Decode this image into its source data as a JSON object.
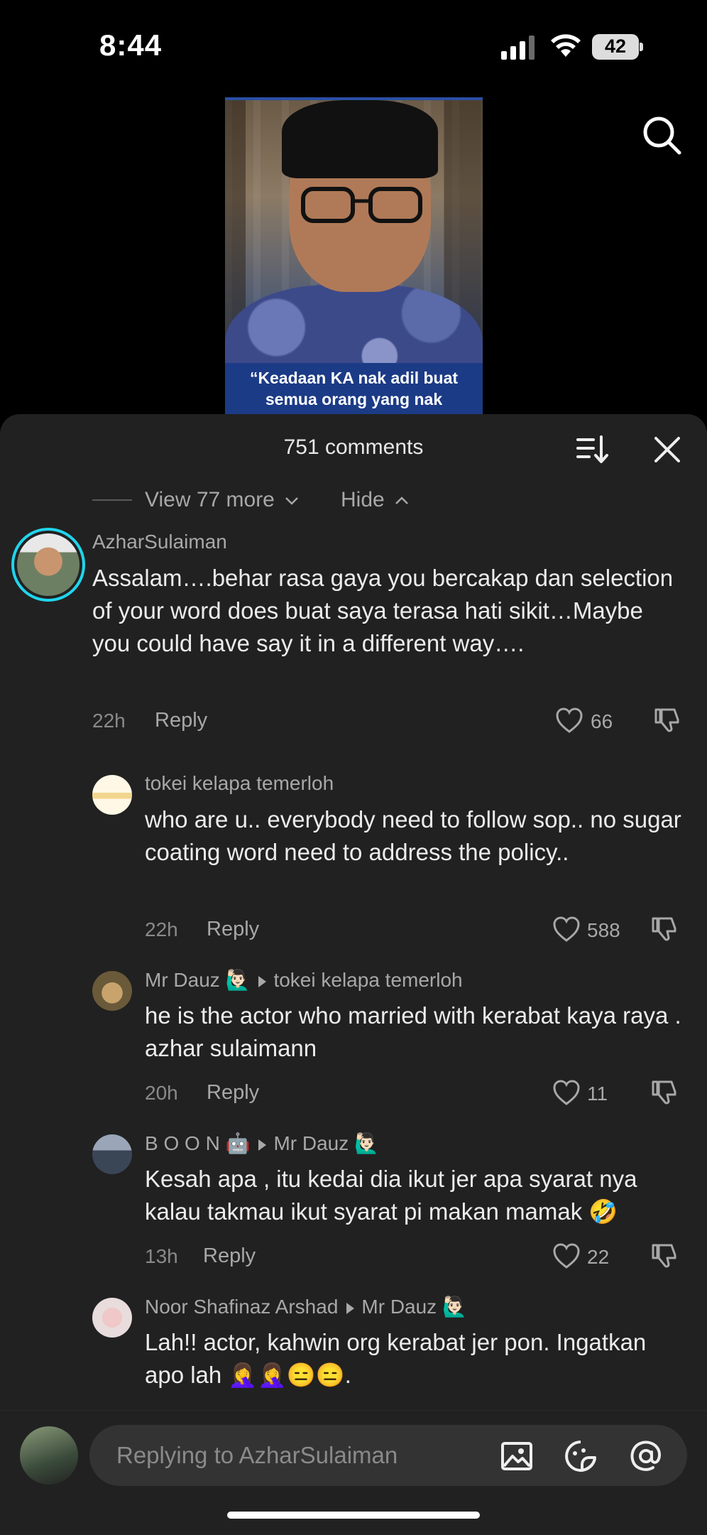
{
  "status": {
    "time": "8:44",
    "battery": "42"
  },
  "video": {
    "caption": "“Keadaan KA nak adil buat semua orang yang nak"
  },
  "header": {
    "count": "751 comments"
  },
  "thread": {
    "view_more": "View 77 more",
    "hide": "Hide"
  },
  "comments": [
    {
      "user": "AzharSulaiman",
      "text": "Assalam….behar rasa gaya you bercakap dan selection of your word does buat saya terasa hati sikit…Maybe you could have say it in a different way….",
      "time": "22h",
      "reply": "Reply",
      "likes": "66"
    },
    {
      "user": "tokei kelapa temerloh",
      "text": "who are u.. everybody need to follow sop.. no sugar coating word need to address the policy..",
      "time": "22h",
      "reply": "Reply",
      "likes": "588"
    },
    {
      "user": "Mr Dauz",
      "user_emoji": "🙋🏻‍♂️",
      "reply_to": "tokei kelapa temerloh",
      "text": "he is the actor who married with kerabat kaya raya . azhar sulaimann",
      "time": "20h",
      "reply": "Reply",
      "likes": "11"
    },
    {
      "user": "B O O N",
      "user_emoji": "🤖",
      "reply_to": "Mr Dauz",
      "reply_to_emoji": "🙋🏻‍♂️",
      "text": "Kesah apa , itu kedai dia ikut jer apa syarat nya kalau takmau ikut syarat pi makan mamak 🤣",
      "time": "13h",
      "reply": "Reply",
      "likes": "22"
    },
    {
      "user": "Noor Shafinaz Arshad",
      "reply_to": "Mr Dauz",
      "reply_to_emoji": "🙋🏻‍♂️",
      "text": "Lah!! actor, kahwin org kerabat jer pon. Ingatkan apo lah 🤦‍♀️🤦‍♀️😑😑."
    }
  ],
  "composer": {
    "placeholder": "Replying to AzharSulaiman"
  },
  "colors": {
    "sheet": "#212121",
    "accent_ring": "#20d5ec"
  }
}
